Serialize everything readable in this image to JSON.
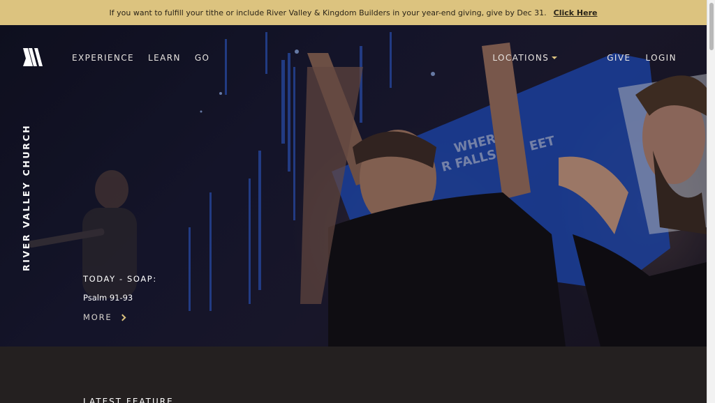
{
  "announcement": {
    "text": "If you want to fulfill your tithe or include River Valley & Kingdom Builders in your year-end giving, give by Dec 31.",
    "link_label": "Click Here"
  },
  "nav": {
    "left": [
      "EXPERIENCE",
      "LEARN",
      "GO"
    ],
    "locations_label": "LOCATIONS",
    "give_label": "GIVE",
    "login_label": "LOGIN"
  },
  "hero": {
    "vertical_title": "RIVER VALLEY CHURCH",
    "soap_label": "TODAY - SOAP:",
    "soap_reference": "Psalm 91-93",
    "more_label": "MORE",
    "banner_text": [
      "WHERE",
      "R FALLS",
      "EET"
    ]
  },
  "lower": {
    "section_title": "LATEST FEATURE"
  },
  "colors": {
    "accent": "#dcc37f",
    "announcement_bg": "#dcc37f",
    "page_bg": "#242020"
  },
  "icons": {
    "logo": "river-valley-logo-icon",
    "caret": "caret-down-icon",
    "chevron": "chevron-right-icon"
  }
}
